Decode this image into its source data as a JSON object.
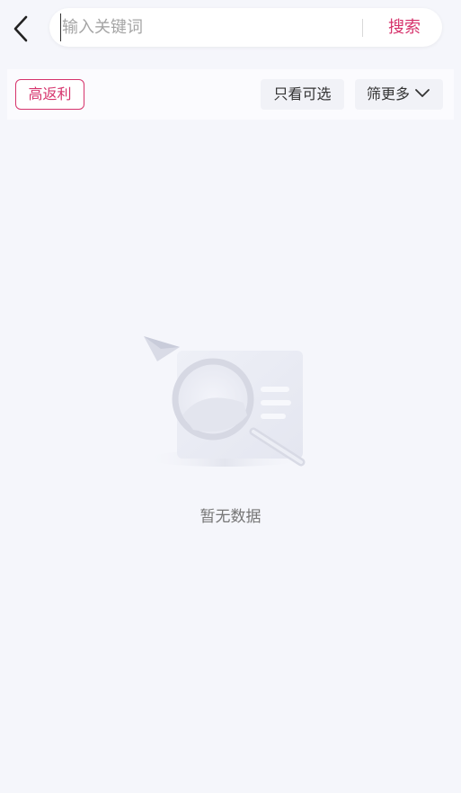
{
  "search": {
    "placeholder": "输入关键词",
    "value": "",
    "button_label": "搜索"
  },
  "icons": {
    "back": "back-arrow-icon",
    "chevron": "chevron-down-icon",
    "empty": "empty-magnifier-illustration"
  },
  "filters": {
    "high_rebate": "高返利",
    "only_available": "只看可选",
    "more_filters": "筛更多"
  },
  "empty_state": {
    "message": "暂无数据"
  },
  "colors": {
    "accent": "#d6336c",
    "background": "#f5f6fb",
    "text_secondary": "#767676"
  }
}
